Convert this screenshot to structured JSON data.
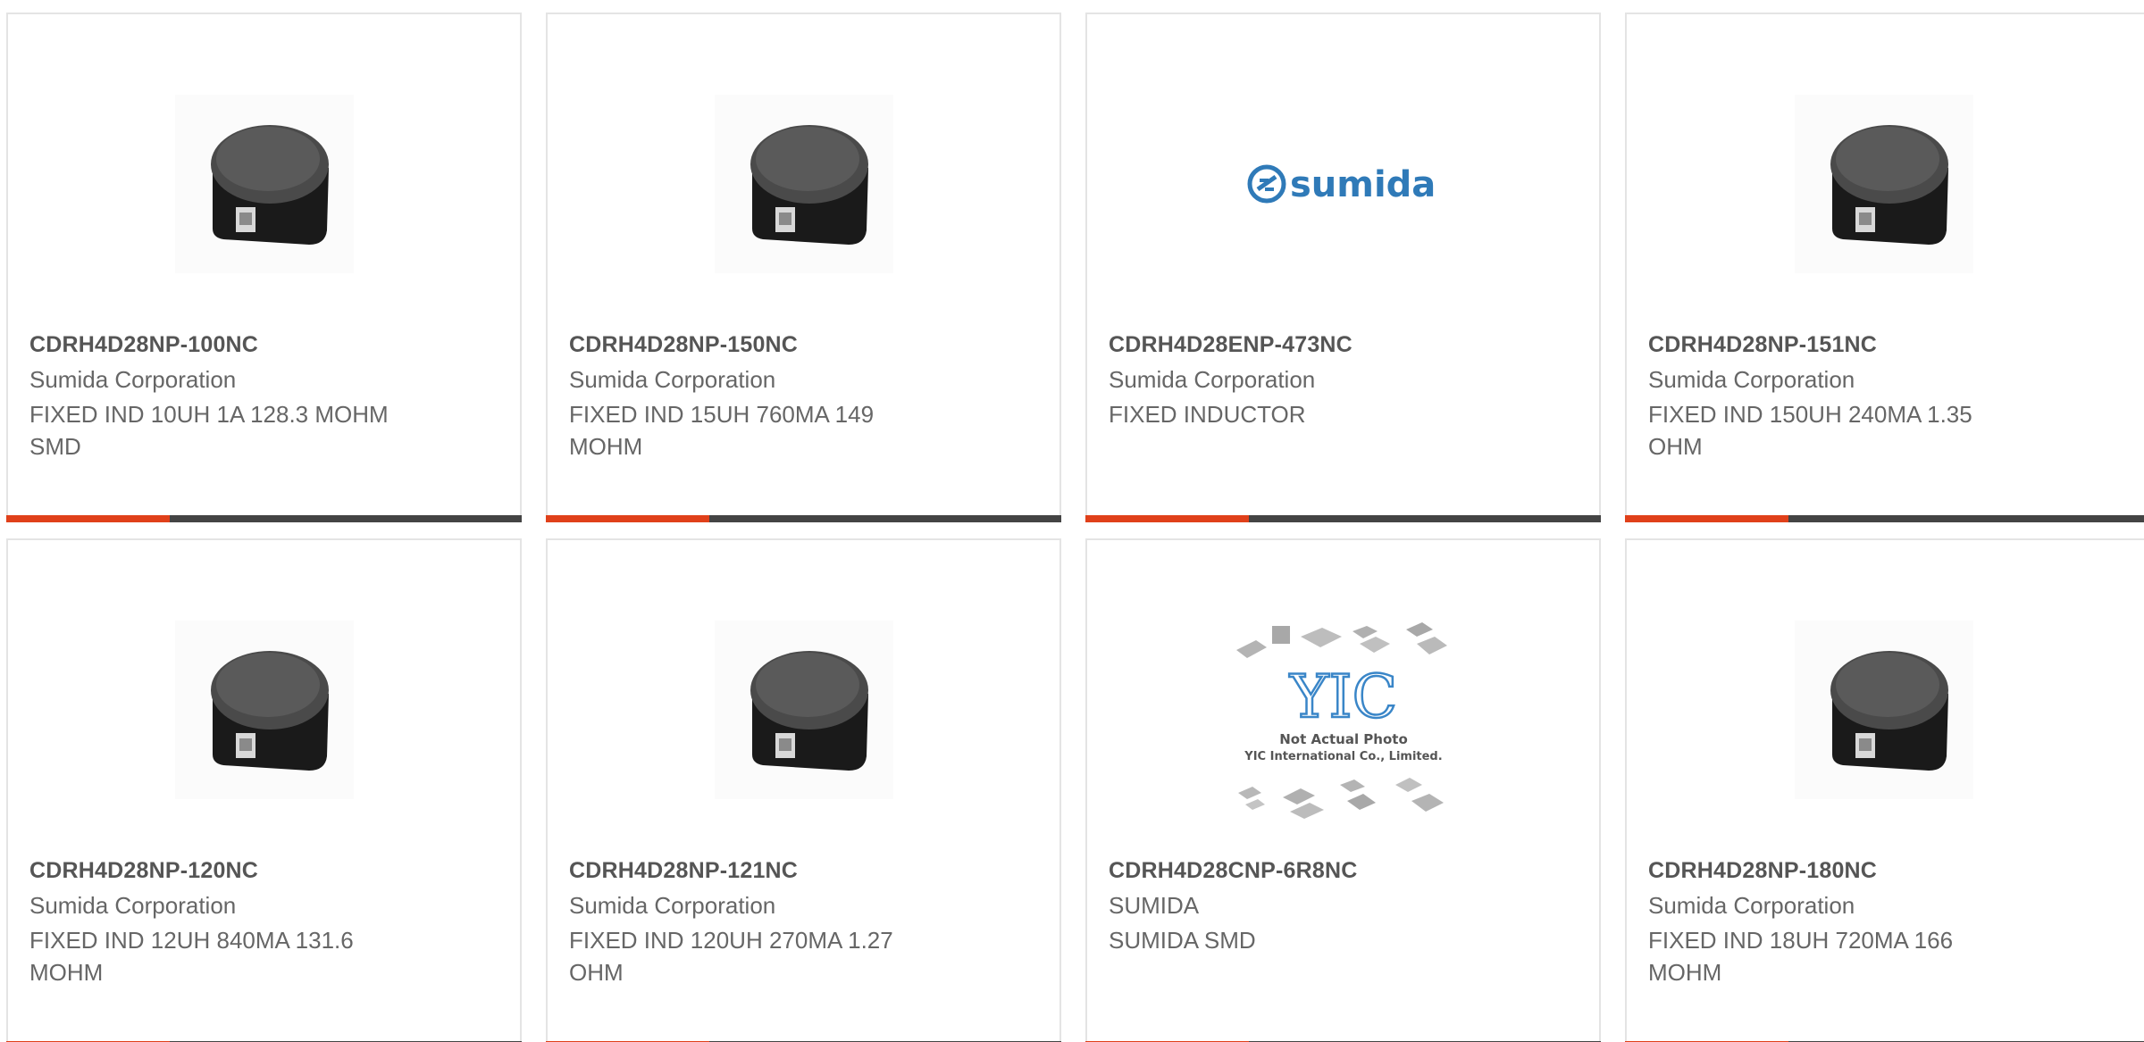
{
  "colors": {
    "accent": "#e0401a",
    "bar_dark": "#444444",
    "border": "#e4e4e4",
    "text": "#666666",
    "sumida_blue": "#2f7ab8"
  },
  "products": [
    {
      "part_number": "CDRH4D28NP-100NC",
      "manufacturer": "Sumida Corporation",
      "description": "FIXED IND 10UH 1A 128.3 MOHM SMD",
      "image": "inductor-photo"
    },
    {
      "part_number": "CDRH4D28NP-150NC",
      "manufacturer": "Sumida Corporation",
      "description": "FIXED IND 15UH 760MA 149 MOHM",
      "image": "inductor-photo"
    },
    {
      "part_number": "CDRH4D28ENP-473NC",
      "manufacturer": "Sumida Corporation",
      "description": "FIXED INDUCTOR",
      "image": "sumida-logo",
      "logo_text": "sumida"
    },
    {
      "part_number": "CDRH4D28NP-151NC",
      "manufacturer": "Sumida Corporation",
      "description": "FIXED IND 150UH 240MA 1.35 OHM",
      "image": "inductor-photo"
    },
    {
      "part_number": "CDRH4D28NP-120NC",
      "manufacturer": "Sumida Corporation",
      "description": "FIXED IND 12UH 840MA 131.6 MOHM",
      "image": "inductor-photo"
    },
    {
      "part_number": "CDRH4D28NP-121NC",
      "manufacturer": "Sumida Corporation",
      "description": "FIXED IND 120UH 270MA 1.27 OHM",
      "image": "inductor-photo"
    },
    {
      "part_number": "CDRH4D28CNP-6R8NC",
      "manufacturer": "SUMIDA",
      "description": "SUMIDA SMD",
      "image": "yic-placeholder",
      "placeholder_text": {
        "logo": "YIC",
        "line1": "Not Actual Photo",
        "line2": "YIC International Co., Limited."
      }
    },
    {
      "part_number": "CDRH4D28NP-180NC",
      "manufacturer": "Sumida Corporation",
      "description": "FIXED IND 18UH 720MA 166 MOHM",
      "image": "inductor-photo"
    }
  ]
}
